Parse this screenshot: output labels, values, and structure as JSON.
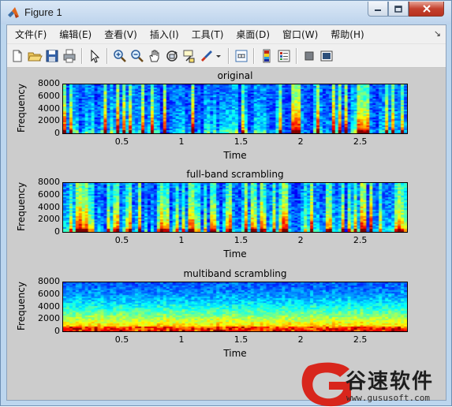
{
  "window": {
    "title": "Figure 1",
    "controls": {
      "minimize": "minimize",
      "maximize": "maximize",
      "close": "close"
    }
  },
  "menu": {
    "items": [
      {
        "label": "文件(F)",
        "name": "menu-file"
      },
      {
        "label": "编辑(E)",
        "name": "menu-edit"
      },
      {
        "label": "查看(V)",
        "name": "menu-view"
      },
      {
        "label": "插入(I)",
        "name": "menu-insert"
      },
      {
        "label": "工具(T)",
        "name": "menu-tools"
      },
      {
        "label": "桌面(D)",
        "name": "menu-desktop"
      },
      {
        "label": "窗口(W)",
        "name": "menu-window"
      },
      {
        "label": "帮助(H)",
        "name": "menu-help"
      }
    ],
    "overflow": "↘"
  },
  "toolbar": {
    "buttons": [
      "new-figure-icon",
      "open-file-icon",
      "save-icon",
      "print-icon",
      "edit-plot-arrow-icon",
      "zoom-in-icon",
      "zoom-out-icon",
      "pan-hand-icon",
      "rotate-3d-icon",
      "data-cursor-icon",
      "brush-icon",
      "brush-dropdown-icon",
      "link-plot-icon",
      "insert-colorbar-icon",
      "insert-legend-icon",
      "hide-plot-tools-icon",
      "show-plot-tools-icon"
    ]
  },
  "colors": {
    "figure_background": "#cccccc",
    "jet_low": "#00008f",
    "jet_high": "#800000"
  },
  "chart_data": [
    {
      "type": "heatmap",
      "title": "original",
      "xlabel": "Time",
      "ylabel": "Frequency",
      "x_ticks": [
        "0.5",
        "1",
        "1.5",
        "2",
        "2.5"
      ],
      "y_ticks": [
        "8000",
        "6000",
        "4000",
        "2000",
        "0"
      ],
      "xlim": [
        0,
        2.9
      ],
      "ylim": [
        0,
        8000
      ],
      "colormap": "jet"
    },
    {
      "type": "heatmap",
      "title": "full-band scrambling",
      "xlabel": "Time",
      "ylabel": "Frequency",
      "x_ticks": [
        "0.5",
        "1",
        "1.5",
        "2",
        "2.5"
      ],
      "y_ticks": [
        "8000",
        "6000",
        "4000",
        "2000",
        "0"
      ],
      "xlim": [
        0,
        2.9
      ],
      "ylim": [
        0,
        8000
      ],
      "colormap": "jet"
    },
    {
      "type": "heatmap",
      "title": "multiband scrambling",
      "xlabel": "Time",
      "ylabel": "Frequency",
      "x_ticks": [
        "0.5",
        "1",
        "1.5",
        "2",
        "2.5"
      ],
      "y_ticks": [
        "8000",
        "6000",
        "4000",
        "2000",
        "0"
      ],
      "xlim": [
        0,
        2.9
      ],
      "ylim": [
        0,
        8000
      ],
      "colormap": "jet"
    }
  ],
  "watermark": {
    "brand": "谷速软件",
    "url": "www.gususoft.com"
  }
}
